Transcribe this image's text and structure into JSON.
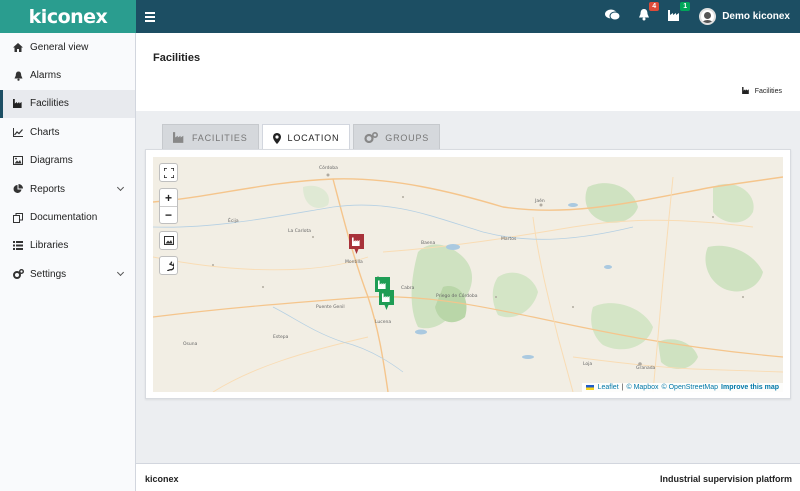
{
  "app": {
    "logo_text": "kiconex",
    "brand_color": "#2a9d8f",
    "header_color": "#1c4e63"
  },
  "header": {
    "menu_icon": "hamburger-icon",
    "icons": [
      {
        "name": "chat-icon"
      },
      {
        "name": "bell-icon",
        "badge": "4",
        "badge_color": "#dd4b39"
      },
      {
        "name": "factory-icon",
        "badge": "1",
        "badge_color": "#00a65a"
      }
    ],
    "user_name": "Demo kiconex"
  },
  "sidebar": {
    "items": [
      {
        "label": "General view",
        "icon": "home-icon"
      },
      {
        "label": "Alarms",
        "icon": "bell-icon"
      },
      {
        "label": "Facilities",
        "icon": "industry-icon",
        "active": true
      },
      {
        "label": "Charts",
        "icon": "line-chart-icon"
      },
      {
        "label": "Diagrams",
        "icon": "image-icon"
      },
      {
        "label": "Reports",
        "icon": "pie-chart-icon",
        "expandable": true
      },
      {
        "label": "Documentation",
        "icon": "copy-icon"
      },
      {
        "label": "Libraries",
        "icon": "list-icon"
      },
      {
        "label": "Settings",
        "icon": "cogs-icon",
        "expandable": true
      }
    ]
  },
  "page": {
    "title": "Facilities",
    "breadcrumb": "Facilities"
  },
  "tabs": [
    {
      "label": "FACILITIES",
      "icon": "industry-icon"
    },
    {
      "label": "LOCATION",
      "icon": "map-marker-icon",
      "active": true
    },
    {
      "label": "GROUPS",
      "icon": "cogs-icon"
    }
  ],
  "map": {
    "markers": [
      {
        "name": "facility-marker-red",
        "color": "#a8323a"
      },
      {
        "name": "facility-marker-green-1",
        "color": "#1f9d55"
      },
      {
        "name": "facility-marker-green-2",
        "color": "#1f9d55"
      }
    ],
    "controls": {
      "zoom_in": "+",
      "zoom_out": "−"
    },
    "attribution": {
      "leaflet": "Leaflet",
      "sep": "|",
      "mapbox": "© Mapbox",
      "osm": "© OpenStreetMap",
      "improve": "Improve this map"
    },
    "place_labels": [
      "Córdoba",
      "Jaén",
      "Granada",
      "Martos",
      "Lucena",
      "Cabra",
      "Priego de Córdoba",
      "Baena",
      "Montilla",
      "Puente Genil",
      "La Carlota",
      "Écija",
      "Estepa",
      "Loja",
      "Osuna"
    ]
  },
  "footer": {
    "left": "kiconex",
    "right": "Industrial supervision platform"
  }
}
